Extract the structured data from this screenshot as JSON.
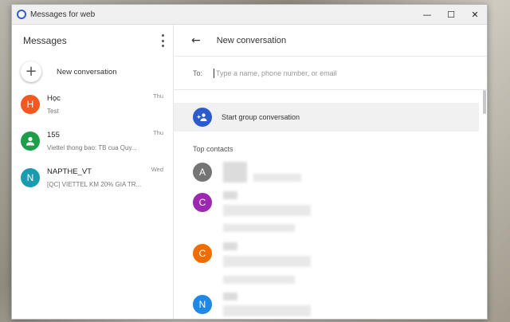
{
  "window": {
    "title": "Messages for web",
    "minimize": "—",
    "maximize": "☐",
    "close": "✕"
  },
  "sidebar": {
    "title": "Messages",
    "new_conversation": "New conversation",
    "conversations": [
      {
        "initial": "H",
        "name": "Học",
        "snippet": "Test",
        "time": "Thu",
        "color": "#f2581f"
      },
      {
        "initial": "",
        "name": "155",
        "snippet": "Viettel thong bao: TB cua Quy...",
        "time": "Thu",
        "color": "#1e9e4b",
        "icon": "person-icon"
      },
      {
        "initial": "N",
        "name": "NAPTHE_VT",
        "snippet": "[QC] VIETTEL KM 20% GIA TR...",
        "time": "Wed",
        "color": "#1a9bb0"
      }
    ]
  },
  "main": {
    "title": "New conversation",
    "to_label": "To:",
    "to_placeholder": "Type a name, phone number, or email",
    "group_label": "Start group conversation",
    "top_contacts_label": "Top contacts",
    "contacts": [
      {
        "initial": "A",
        "color": "#757575"
      },
      {
        "initial": "C",
        "color": "#9c27b0"
      },
      {
        "initial": "C",
        "color": "#ef6c00"
      },
      {
        "initial": "N",
        "color": "#1e88e5"
      }
    ]
  },
  "colors": {
    "accent": "#2c5ccc",
    "group_row_bg": "#f1f1f1"
  }
}
